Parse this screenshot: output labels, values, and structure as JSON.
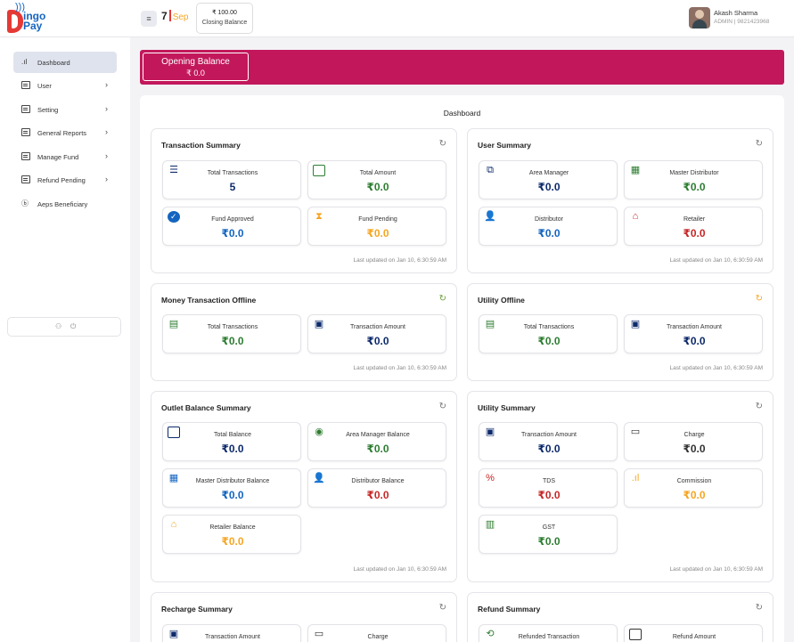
{
  "header": {
    "logo_text_top": "ingo",
    "logo_text_bottom": "Pay",
    "menu_icon": "hamburger-icon",
    "date_day": "7",
    "date_month": "Sep",
    "closing_amount": "₹ 100.00",
    "closing_label": "Closing Balance",
    "user_name": "Akash Sharma",
    "user_role": "ADMIN | 9821423968"
  },
  "sidebar": {
    "items": [
      {
        "label": "Dashboard",
        "icon": "bar-chart-icon",
        "active": true
      },
      {
        "label": "User",
        "icon": "list-icon"
      },
      {
        "label": "Setting",
        "icon": "list-icon"
      },
      {
        "label": "General Reports",
        "icon": "list-icon"
      },
      {
        "label": "Manage Fund",
        "icon": "list-icon"
      },
      {
        "label": "Refund Pending",
        "icon": "list-icon"
      },
      {
        "label": "Aeps Beneficiary",
        "icon": "rupee-circle-icon"
      }
    ],
    "bottom_icons": [
      "user-icon",
      "power-icon"
    ]
  },
  "banner": {
    "title": "Opening Balance",
    "value": "₹ 0.0",
    "color": "#c2185b"
  },
  "main": {
    "title": "Dashboard",
    "updated_text": "Last updated on Jan 10, 6:30:59 AM"
  },
  "cards": {
    "transaction_summary": {
      "title": "Transaction Summary",
      "tiles": [
        {
          "label": "Total Transactions",
          "value": "5",
          "icon": "checklist-icon"
        },
        {
          "label": "Total Amount",
          "value": "₹0.0",
          "icon": "wallet-icon"
        },
        {
          "label": "Fund Approved",
          "value": "₹0.0",
          "icon": "check-circle-icon"
        },
        {
          "label": "Fund Pending",
          "value": "₹0.0",
          "icon": "hourglass-icon"
        }
      ]
    },
    "user_summary": {
      "title": "User Summary",
      "tiles": [
        {
          "label": "Area Manager",
          "value": "₹0.0",
          "icon": "manager-icon"
        },
        {
          "label": "Master Distributor",
          "value": "₹0.0",
          "icon": "building-icon"
        },
        {
          "label": "Distributor",
          "value": "₹0.0",
          "icon": "user-check-icon"
        },
        {
          "label": "Retailer",
          "value": "₹0.0",
          "icon": "store-icon"
        }
      ]
    },
    "money_offline": {
      "title": "Money Transaction Offline",
      "tiles": [
        {
          "label": "Total Transactions",
          "value": "₹0.0",
          "icon": "ledger-icon"
        },
        {
          "label": "Transaction Amount",
          "value": "₹0.0",
          "icon": "cash-icon"
        }
      ]
    },
    "utility_offline": {
      "title": "Utility Offline",
      "tiles": [
        {
          "label": "Total Transactions",
          "value": "₹0.0",
          "icon": "ledger-icon"
        },
        {
          "label": "Transaction Amount",
          "value": "₹0.0",
          "icon": "cash-icon"
        }
      ]
    },
    "outlet_balance": {
      "title": "Outlet Balance Summary",
      "tiles": [
        {
          "label": "Total Balance",
          "value": "₹0.0",
          "icon": "wallet-icon"
        },
        {
          "label": "Area Manager Balance",
          "value": "₹0.0",
          "icon": "user-circle-icon"
        },
        {
          "label": "Master Distributor Balance",
          "value": "₹0.0",
          "icon": "building-icon"
        },
        {
          "label": "Distributor Balance",
          "value": "₹0.0",
          "icon": "user-list-icon"
        },
        {
          "label": "Retailer Balance",
          "value": "₹0.0",
          "icon": "store-icon"
        }
      ]
    },
    "utility_summary": {
      "title": "Utility Summary",
      "tiles": [
        {
          "label": "Transaction Amount",
          "value": "₹0.0",
          "icon": "cash-icon"
        },
        {
          "label": "Charge",
          "value": "₹0.0",
          "icon": "receipt-icon"
        },
        {
          "label": "TDS",
          "value": "₹0.0",
          "icon": "percent-icon"
        },
        {
          "label": "Commission",
          "value": "₹0.0",
          "icon": "bar-chart-icon"
        },
        {
          "label": "GST",
          "value": "₹0.0",
          "icon": "document-chart-icon"
        }
      ]
    },
    "recharge_summary": {
      "title": "Recharge Summary",
      "tiles": [
        {
          "label": "Transaction Amount",
          "icon": "cash-icon"
        },
        {
          "label": "Charge",
          "icon": "receipt-icon"
        }
      ]
    },
    "refund_summary": {
      "title": "Refund Summary",
      "tiles": [
        {
          "label": "Refunded Transaction",
          "icon": "refund-icon"
        },
        {
          "label": "Refund Amount",
          "icon": "wallet-icon"
        }
      ]
    }
  },
  "colors": {
    "accent": "#c2185b",
    "blue": "#1565c0",
    "green": "#2e7d32",
    "orange": "#f5a623",
    "red": "#c62828"
  }
}
